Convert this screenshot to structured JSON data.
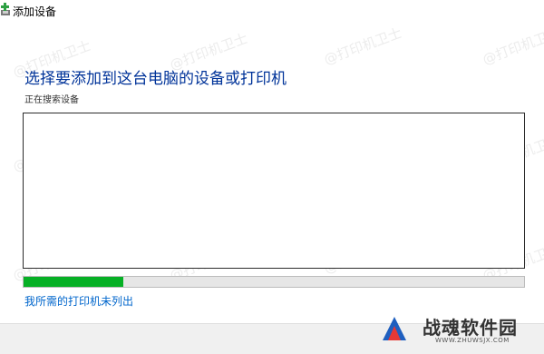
{
  "window": {
    "title": "添加设备",
    "icon": "add-device-icon"
  },
  "main": {
    "heading": "选择要添加到这台电脑的设备或打印机",
    "status": "正在搜索设备",
    "progress_percent": 20,
    "progress_color": "#06b025",
    "not_listed_link": "我所需的打印机未列出",
    "link_color": "#0066cc"
  },
  "watermark": {
    "text": "@打印机卫士"
  },
  "brand_badge": {
    "name": "战魂软件园",
    "url": "WWW.ZHUWSJX.COM"
  }
}
